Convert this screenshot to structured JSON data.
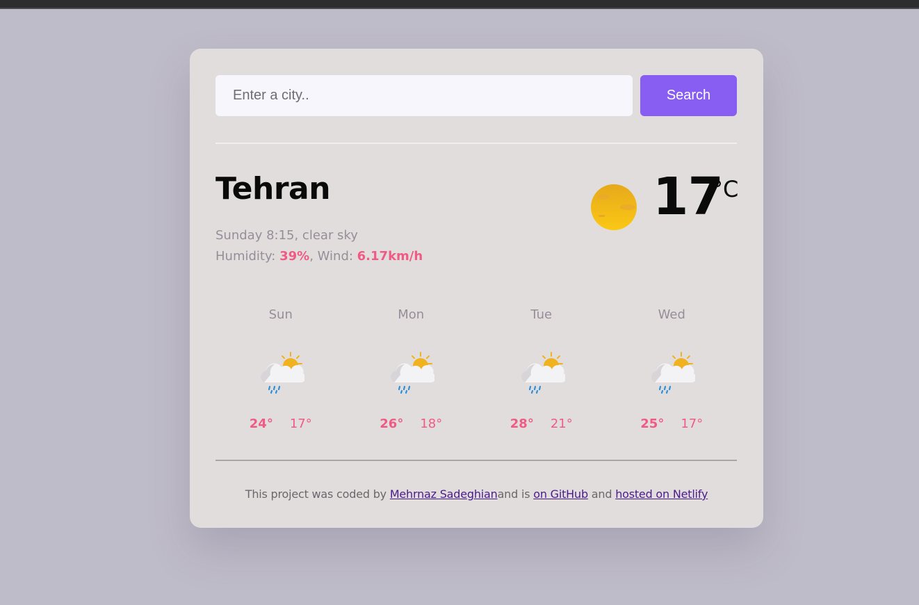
{
  "search": {
    "placeholder": "Enter a city..",
    "value": "",
    "button_label": "Search"
  },
  "current": {
    "city": "Tehran",
    "datetime_description": "Sunday 8:15, clear sky",
    "humidity_label": "Humidity: ",
    "humidity": "39%",
    "wind_label": ", Wind: ",
    "wind": "6.17km/h",
    "temperature": "17",
    "unit": "°C",
    "icon": "clear-sky-sun-icon"
  },
  "forecast": [
    {
      "day": "Sun",
      "max": "24°",
      "min": "17°",
      "icon": "cloud-sun-rain-icon"
    },
    {
      "day": "Mon",
      "max": "26°",
      "min": "18°",
      "icon": "cloud-sun-rain-icon"
    },
    {
      "day": "Tue",
      "max": "28°",
      "min": "21°",
      "icon": "cloud-sun-rain-icon"
    },
    {
      "day": "Wed",
      "max": "25°",
      "min": "17°",
      "icon": "cloud-sun-rain-icon"
    }
  ],
  "footer": {
    "text_1": "This project was coded by ",
    "author_link": "Mehrnaz Sadeghian",
    "text_2": "and is ",
    "github_link": "on GitHub",
    "text_3": " and ",
    "netlify_link": "hosted on Netlify"
  },
  "colors": {
    "page_background": "#bfbcc9",
    "card_background": "#e2dddd",
    "accent_button": "#885df1",
    "accent_text": "#ef5b84",
    "muted_text": "#958e99",
    "link": "#4b1b8a"
  }
}
